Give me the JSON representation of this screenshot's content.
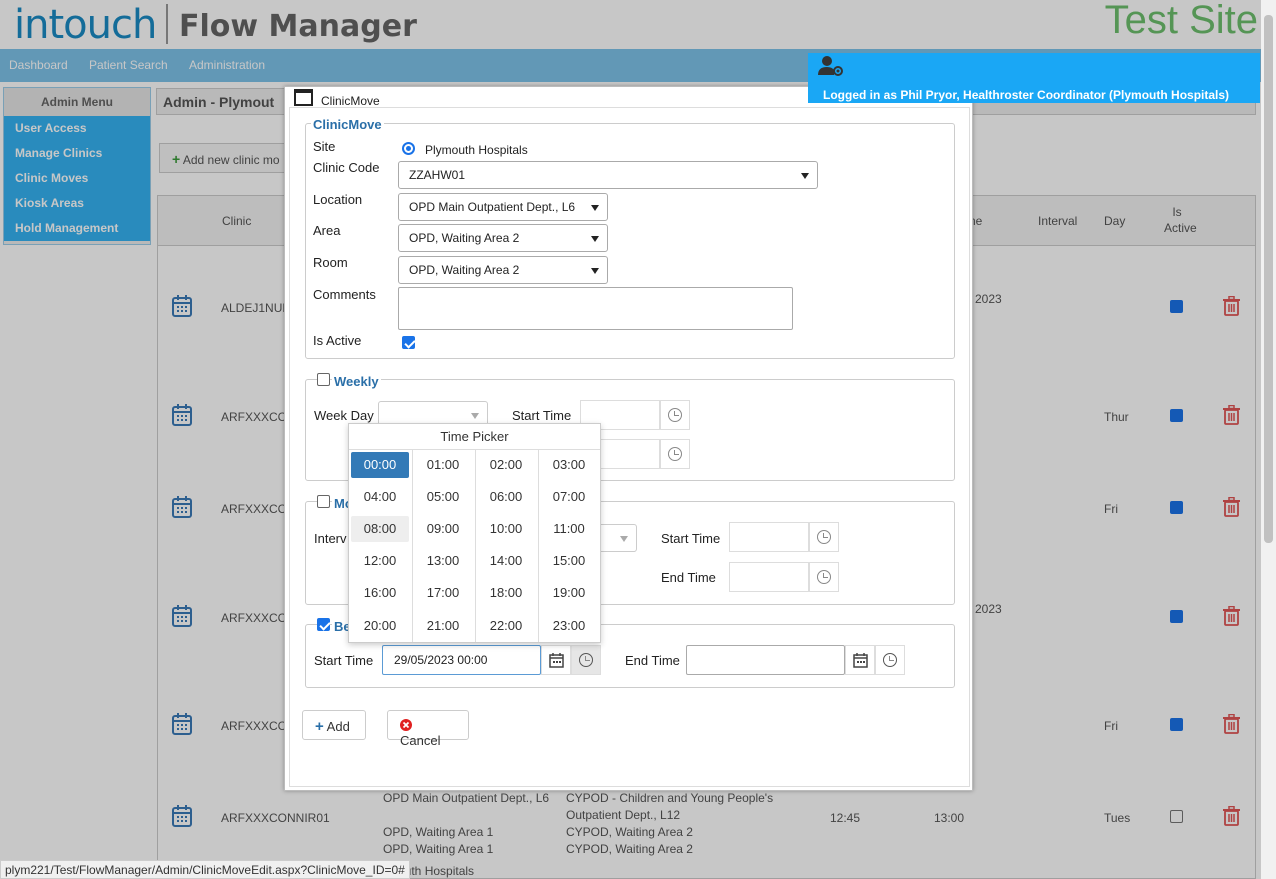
{
  "app": {
    "logo": "intouch",
    "product": "Flow Manager",
    "site_label": "Test Site"
  },
  "nav": {
    "items": [
      "Dashboard",
      "Patient Search",
      "Administration"
    ]
  },
  "user": {
    "logged_in": "Logged in as Phil Pryor, Healthroster Coordinator (Plymouth Hospitals)"
  },
  "admin_menu": {
    "title": "Admin Menu",
    "items": [
      "User Access",
      "Manage Clinics",
      "Clinic Moves",
      "Kiosk Areas",
      "Hold Management"
    ]
  },
  "breadcrumb": "Admin - Plymout",
  "add_clinic_label": "Add new clinic mo",
  "grid": {
    "headers": {
      "clinic": "Clinic",
      "time": "ne",
      "interval": "Interval",
      "day": "Day",
      "is_active": "Is Active"
    },
    "rows": [
      {
        "code": "ALDEJ1NUR",
        "date": "2023",
        "day": "",
        "active": true
      },
      {
        "code": "ARFXXXCC",
        "date": "",
        "day": "Thur",
        "active": true
      },
      {
        "code": "ARFXXXCC",
        "date": "",
        "day": "Fri",
        "active": true
      },
      {
        "code": "ARFXXXCC",
        "date": "2023",
        "day": "",
        "active": true
      },
      {
        "code": "ARFXXXCC",
        "date": "",
        "day": "Fri",
        "active": true
      },
      {
        "code": "ARFXXXCONNIR01",
        "date": "",
        "day": "Tues",
        "active": false,
        "from_location": "OPD Main Outpatient Dept., L6",
        "from_area": "OPD, Waiting Area 1",
        "from_room": "OPD, Waiting Area 1",
        "from_site": "outh Hospitals",
        "to_location": "CYPOD - Children and Young People's Outpatient Dept., L12",
        "to_area": "CYPOD, Waiting Area 2",
        "to_room": "CYPOD, Waiting Area 2",
        "start": "12:45",
        "end": "13:00"
      }
    ]
  },
  "status_url": "plym221/Test/FlowManager/Admin/ClinicMoveEdit.aspx?ClinicMove_ID=0#",
  "dialog": {
    "title": "ClinicMove",
    "section_title": "ClinicMove",
    "site_label": "Site",
    "site_value": "Plymouth Hospitals",
    "clinic_code_label": "Clinic Code",
    "clinic_code_value": "ZZAHW01",
    "location_label": "Location",
    "location_value": "OPD Main Outpatient Dept., L6",
    "area_label": "Area",
    "area_value": "OPD, Waiting Area 2",
    "room_label": "Room",
    "room_value": "OPD, Waiting Area 2",
    "comments_label": "Comments",
    "comments_value": "",
    "is_active_label": "Is Active",
    "is_active": true,
    "weekly": {
      "title": "Weekly",
      "checked": false,
      "weekday_label": "Week Day",
      "weekday_value": "",
      "start_time_label": "Start Time"
    },
    "monthly": {
      "title": "Mo",
      "checked": false,
      "interval_label": "Interv",
      "start_time_label": "Start Time",
      "end_time_label": "End Time"
    },
    "between": {
      "title": "Be",
      "checked": true,
      "start_time_label": "Start Time",
      "start_time_value": "29/05/2023 00:00",
      "end_time_label": "End Time",
      "end_time_value": ""
    },
    "add_label": "Add",
    "cancel_label": "Cancel"
  },
  "time_picker": {
    "title": "Time Picker",
    "times": [
      "00:00",
      "01:00",
      "02:00",
      "03:00",
      "04:00",
      "05:00",
      "06:00",
      "07:00",
      "08:00",
      "09:00",
      "10:00",
      "11:00",
      "12:00",
      "13:00",
      "14:00",
      "15:00",
      "16:00",
      "17:00",
      "18:00",
      "19:00",
      "20:00",
      "21:00",
      "22:00",
      "23:00"
    ],
    "selected": "00:00",
    "hovered": "08:00"
  },
  "colors": {
    "accent": "#1aa7f5",
    "nav": "#7ec3ea",
    "selected": "#337ab7",
    "test_site": "#6dbf6d",
    "delete": "#e05555"
  }
}
